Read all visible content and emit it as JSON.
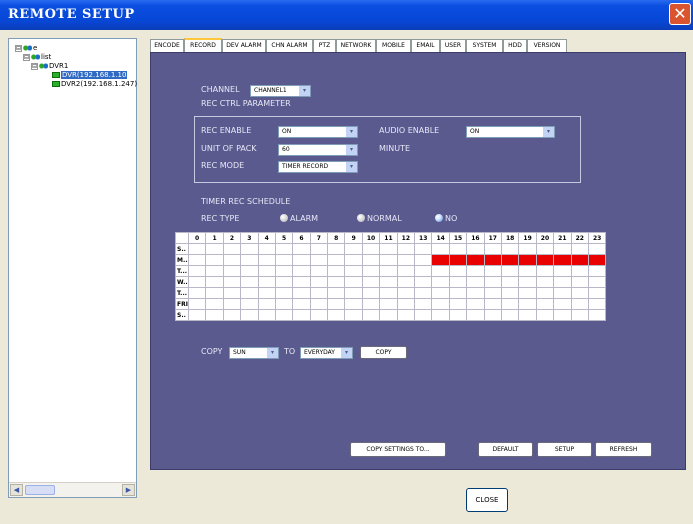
{
  "window": {
    "title": "REMOTE SETUP",
    "close_glyph": "✕"
  },
  "tree": {
    "items": [
      {
        "toggle": "⊟",
        "label": "e"
      },
      {
        "toggle": "⊟",
        "label": "list"
      },
      {
        "toggle": "⊟",
        "label": "DVR1"
      },
      {
        "toggle": "",
        "label": "DVR(192.168.1.10"
      },
      {
        "toggle": "",
        "label": "DVR2(192.168.1.247)"
      }
    ],
    "scroll_left": "◀",
    "scroll_right": "▶"
  },
  "tabs": [
    "ENCODE",
    "RECORD",
    "DEV ALARM",
    "CHN ALARM",
    "PTZ",
    "NETWORK",
    "MOBILE",
    "EMAIL",
    "USER",
    "SYSTEM",
    "HDD",
    "VERSION"
  ],
  "record": {
    "channel_label": "CHANNEL",
    "channel_value": "CHANNEL1",
    "rec_ctrl_title": "REC CTRL PARAMETER",
    "rec_enable_label": "REC ENABLE",
    "rec_enable_value": "ON",
    "audio_enable_label": "AUDIO ENABLE",
    "audio_enable_value": "ON",
    "unit_of_pack_label": "UNIT OF PACK",
    "unit_of_pack_value": "60",
    "minute_label": "MINUTE",
    "rec_mode_label": "REC MODE",
    "rec_mode_value": "TIMER RECORD",
    "timer_title": "TIMER REC SCHEDULE",
    "rec_type_label": "REC TYPE",
    "rec_type_options": [
      "ALARM",
      "NORMAL",
      "NO"
    ],
    "rec_type_selected": "NO",
    "arrow_glyph": "▾"
  },
  "schedule": {
    "hours": [
      "0",
      "1",
      "2",
      "3",
      "4",
      "5",
      "6",
      "7",
      "8",
      "9",
      "10",
      "11",
      "12",
      "13",
      "14",
      "15",
      "16",
      "17",
      "18",
      "19",
      "20",
      "21",
      "22",
      "23"
    ],
    "days": [
      "S..",
      "M..",
      "T...",
      "W..",
      "T...",
      "FRI",
      "S.."
    ],
    "active": [
      [],
      [
        14,
        15,
        16,
        17,
        18,
        19,
        20,
        21,
        22,
        23
      ],
      [],
      [],
      [],
      [],
      []
    ],
    "active_color": "#e90000"
  },
  "copy": {
    "label": "COPY",
    "from_value": "SUN",
    "to_label": "TO",
    "to_value": "EVERYDAY",
    "button": "COPY"
  },
  "buttons": {
    "copy_settings": "COPY SETTINGS TO...",
    "default": "DEFAULT",
    "setup": "SETUP",
    "refresh": "REFRESH",
    "close": "CLOSE"
  }
}
